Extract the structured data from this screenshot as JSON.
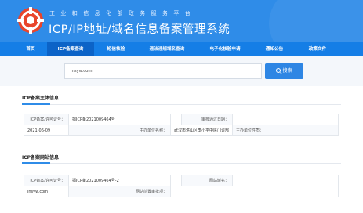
{
  "header": {
    "subtitle": "工业和信息化部政务服务平台",
    "title": "ICP/IP地址/域名信息备案管理系统"
  },
  "nav": {
    "items": [
      {
        "label": "首页",
        "active": false
      },
      {
        "label": "ICP备案查询",
        "active": true
      },
      {
        "label": "短信核验",
        "active": false
      },
      {
        "label": "违法违规域名查询",
        "active": false
      },
      {
        "label": "电子化核验申请",
        "active": false
      },
      {
        "label": "通知公告",
        "active": false
      },
      {
        "label": "政策文件",
        "active": false
      }
    ]
  },
  "search": {
    "value": "lnsyw.com",
    "button_label": "搜索"
  },
  "subject_section": {
    "title": "ICP备案主体信息",
    "license_label": "ICP备案/许可证号：",
    "license_value": "鄂ICP备2021009464号",
    "audit_date_label": "审核通过日期：",
    "audit_date_value": "2021-06-09",
    "org_name_label": "主办单位名称：",
    "org_name_value": "武汉市洪山区李小平中医门诊部",
    "org_type_label": "主办单位性质："
  },
  "website_section": {
    "title": "ICP备案网站信息",
    "license_label": "ICP备案/许可证号：",
    "license_value": "鄂ICP备2021009464号-2",
    "domain_label": "网站域名：",
    "domain_value": "lnsyw.com",
    "prereq_label": "网站前置审批项："
  },
  "colors": {
    "header_bg": "#2f8ce8",
    "nav_bg": "#157ee6",
    "nav_active_bg": "#0c63c7",
    "button_bg": "#2e86e4"
  }
}
